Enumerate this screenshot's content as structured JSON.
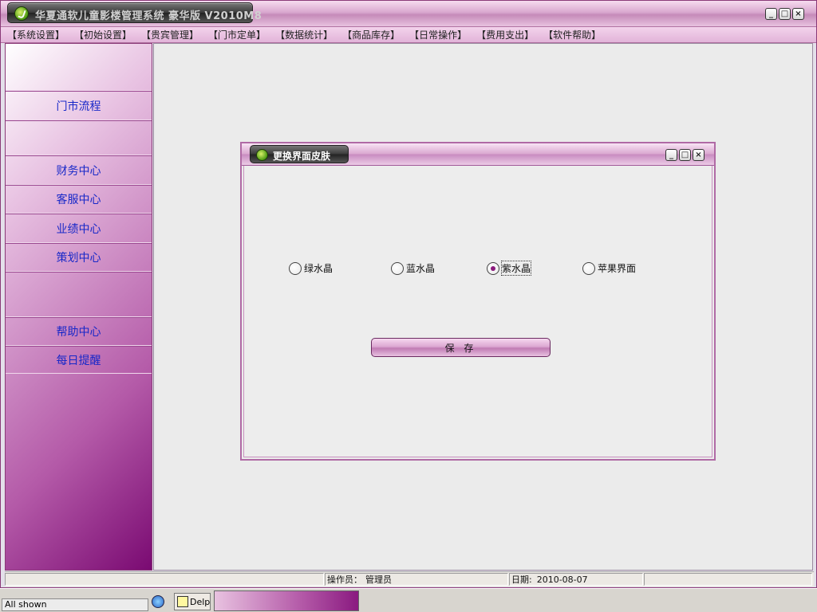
{
  "window": {
    "title": "华夏通软儿童影楼管理系统 豪华版 V2010M8",
    "controls": [
      "minimize",
      "maximize",
      "close"
    ]
  },
  "menu": {
    "items": [
      "【系统设置】",
      "【初始设置】",
      "【贵宾管理】",
      "【门市定单】",
      "【数据统计】",
      "【商品库存】",
      "【日常操作】",
      "【费用支出】",
      "【软件帮助】"
    ]
  },
  "sidebar": {
    "items": [
      {
        "label": ""
      },
      {
        "label": "门市流程"
      },
      {
        "label": ""
      },
      {
        "label": "财务中心"
      },
      {
        "label": "客服中心"
      },
      {
        "label": "业绩中心"
      },
      {
        "label": "策划中心"
      },
      {
        "label": ""
      },
      {
        "label": "帮助中心"
      },
      {
        "label": "每日提醒"
      }
    ]
  },
  "dialog": {
    "title": "更换界面皮肤",
    "options": [
      {
        "label": "绿水晶",
        "checked": false
      },
      {
        "label": "蓝水晶",
        "checked": false
      },
      {
        "label": "紫水晶",
        "checked": true
      },
      {
        "label": "苹果界面",
        "checked": false
      }
    ],
    "save_label": "保 存"
  },
  "status": {
    "operator_label": "操作员：",
    "operator_value": "管理员",
    "date_label": "日期:",
    "date_value": "2010-08-07"
  },
  "taskbar": {
    "filter_text": "All shown",
    "delphi_label": "Delpl"
  },
  "colors": {
    "accent": "#b45aa8",
    "link": "#1828c8",
    "dark_purple": "#7a0a72"
  }
}
